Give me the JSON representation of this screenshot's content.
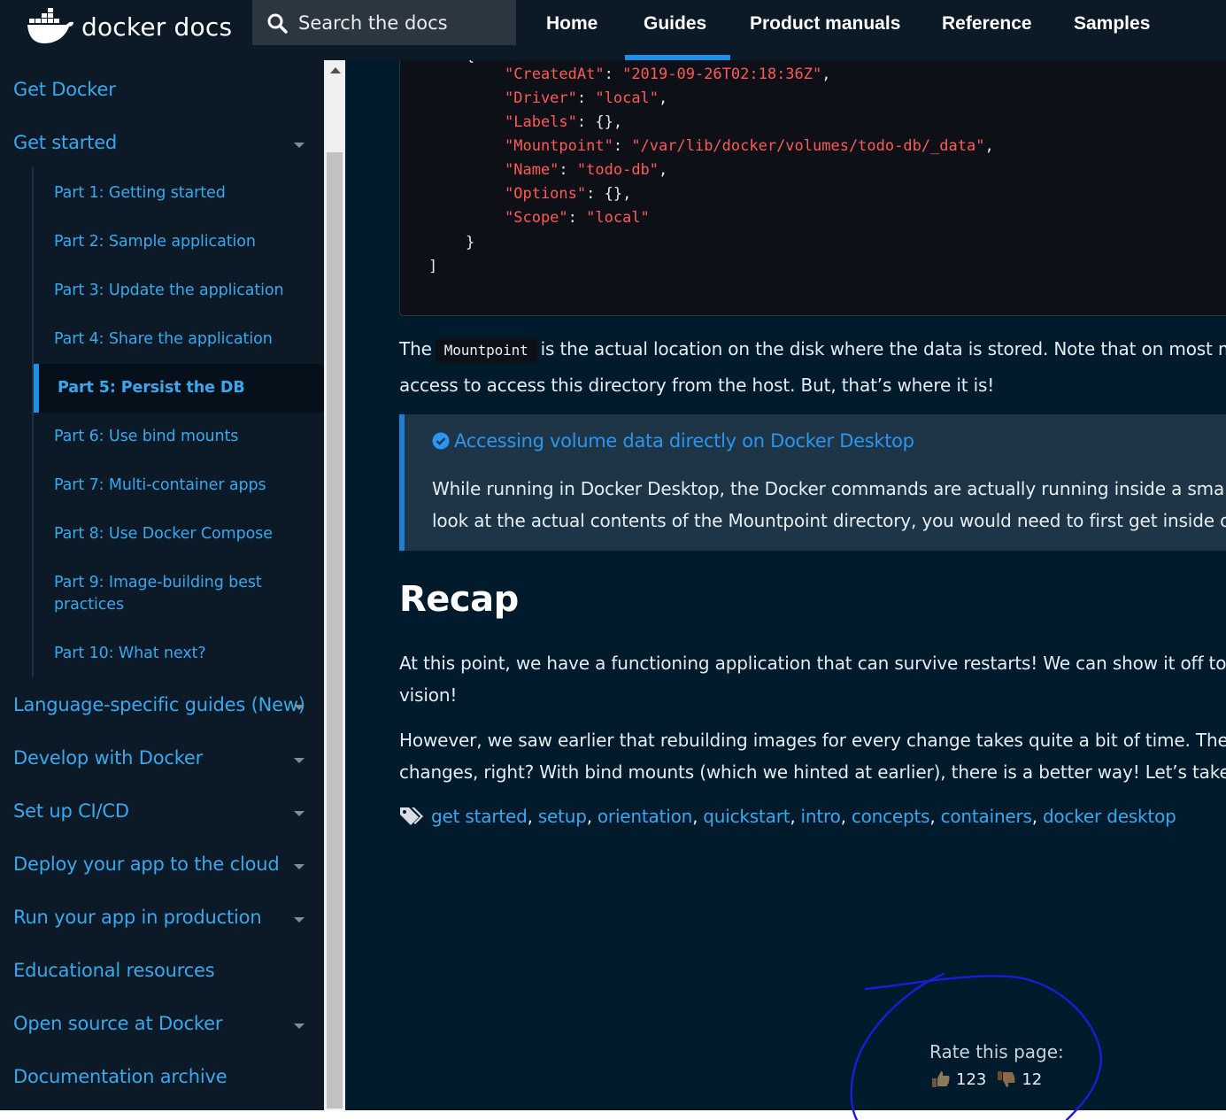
{
  "nav": {
    "logo_text": "docker docs",
    "search_placeholder": "Search the docs",
    "items": [
      "Home",
      "Guides",
      "Product manuals",
      "Reference",
      "Samples"
    ],
    "active": "Guides"
  },
  "sidebar": {
    "get_docker": "Get Docker",
    "get_started": "Get started",
    "parts": [
      "Part 1: Getting started",
      "Part 2: Sample application",
      "Part 3: Update the application",
      "Part 4: Share the application",
      "Part 5: Persist the DB",
      "Part 6: Use bind mounts",
      "Part 7: Multi-container apps",
      "Part 8: Use Docker Compose",
      "Part 9: Image-building best practices",
      "Part 10: What next?"
    ],
    "active_part": "Part 5: Persist the DB",
    "sections": [
      "Language-specific guides (New)",
      "Develop with Docker",
      "Set up CI/CD",
      "Deploy your app to the cloud",
      "Run your app in production",
      "Educational resources",
      "Open source at Docker",
      "Documentation archive"
    ]
  },
  "code": {
    "open_brace": "{",
    "lines": [
      {
        "key": "\"CreatedAt\"",
        "value": "\"2019-09-26T02:18:36Z\"",
        "tail": ","
      },
      {
        "key": "\"Driver\"",
        "value": "\"local\"",
        "tail": ","
      },
      {
        "key": "\"Labels\"",
        "value": "",
        "tail": " {},"
      },
      {
        "key": "\"Mountpoint\"",
        "value": "\"/var/lib/docker/volumes/todo-db/_data\"",
        "tail": ","
      },
      {
        "key": "\"Name\"",
        "value": "\"todo-db\"",
        "tail": ","
      },
      {
        "key": "\"Options\"",
        "value": "",
        "tail": " {},"
      },
      {
        "key": "\"Scope\"",
        "value": "\"local\"",
        "tail": ""
      }
    ],
    "close_brace": "}",
    "close_bracket": "]"
  },
  "mountpoint_para": {
    "before": "The",
    "code": "Mountpoint",
    "after": "is the actual location on the disk where the data is stored. Note that on most m",
    "line2": "access to access this directory from the host. But, that’s where it is!"
  },
  "callout": {
    "title": "Accessing volume data directly on Docker Desktop",
    "line1": "While running in Docker Desktop, the Docker commands are actually running inside a small",
    "line2": "look at the actual contents of the Mountpoint directory, you would need to first get inside of"
  },
  "recap": {
    "heading": "Recap",
    "p1_line1": "At this point, we have a functioning application that can survive restarts! We can show it off to ou",
    "p1_line2": "vision!",
    "p2_line1": "However, we saw earlier that rebuilding images for every change takes quite a bit of time. There",
    "p2_line2": "changes, right? With bind mounts (which we hinted at earlier), there is a better way! Let’s take a"
  },
  "tags": [
    "get started",
    "setup",
    "orientation",
    "quickstart",
    "intro",
    "concepts",
    "containers",
    "docker desktop"
  ],
  "rating": {
    "label": "Rate this page:",
    "up_count": "123",
    "down_count": "12"
  },
  "colors": {
    "nav_bg": "#0b1a26",
    "main_bg": "#011a2c",
    "link": "#38a8ef",
    "accent": "#1d91e5",
    "code_string": "#ff5a55",
    "annotation": "#1c1cd8"
  }
}
